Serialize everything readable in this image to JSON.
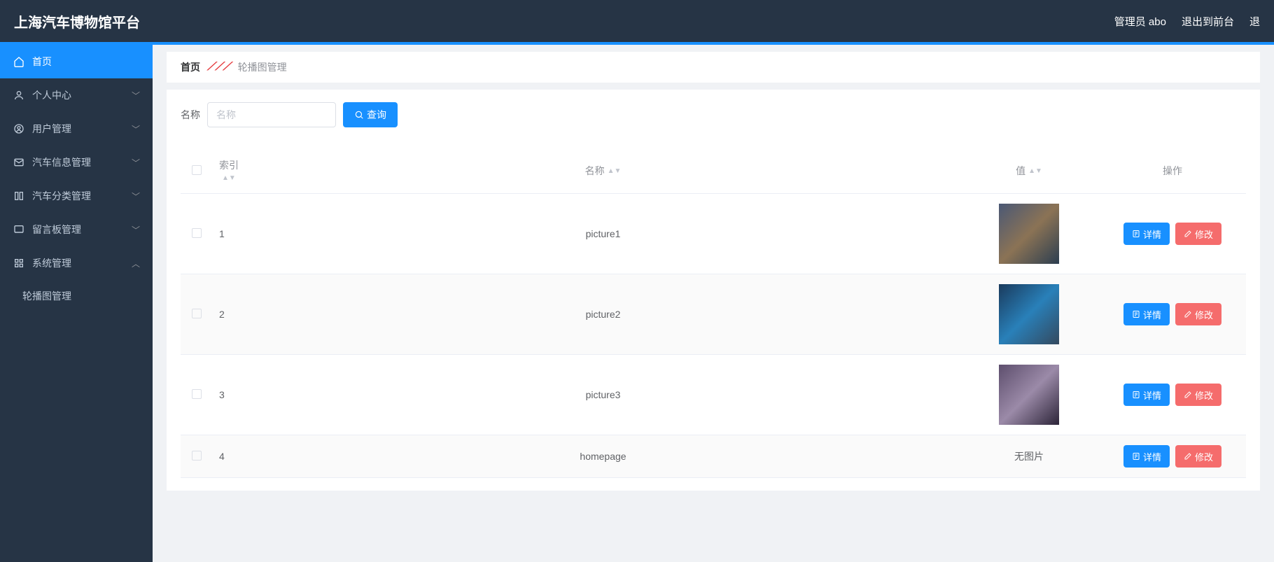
{
  "header": {
    "brand": "上海汽车博物馆平台",
    "user": "管理员 abo",
    "logout": "退出到前台",
    "exit": "退"
  },
  "sidebar": {
    "items": [
      {
        "label": "首页",
        "icon": "home",
        "active": true,
        "expandable": false
      },
      {
        "label": "个人中心",
        "icon": "user",
        "expandable": true
      },
      {
        "label": "用户管理",
        "icon": "badge",
        "expandable": true
      },
      {
        "label": "汽车信息管理",
        "icon": "mail",
        "expandable": true
      },
      {
        "label": "汽车分类管理",
        "icon": "list",
        "expandable": true
      },
      {
        "label": "留言板管理",
        "icon": "board",
        "expandable": true
      },
      {
        "label": "系统管理",
        "icon": "grid",
        "expandable": true,
        "open": true
      }
    ],
    "sub": {
      "label": "轮播图管理"
    }
  },
  "breadcrumb": {
    "home": "首页",
    "current": "轮播图管理"
  },
  "search": {
    "label": "名称",
    "placeholder": "名称",
    "button": "查询"
  },
  "table": {
    "headers": {
      "index": "索引",
      "name": "名称",
      "value": "值",
      "op": "操作"
    },
    "no_image": "无图片",
    "rows": [
      {
        "index": "1",
        "name": "picture1",
        "has_image": true,
        "thumb_class": "t1"
      },
      {
        "index": "2",
        "name": "picture2",
        "has_image": true,
        "thumb_class": "t2"
      },
      {
        "index": "3",
        "name": "picture3",
        "has_image": true,
        "thumb_class": "t3"
      },
      {
        "index": "4",
        "name": "homepage",
        "has_image": false
      }
    ],
    "actions": {
      "detail": "详情",
      "edit": "修改"
    }
  }
}
